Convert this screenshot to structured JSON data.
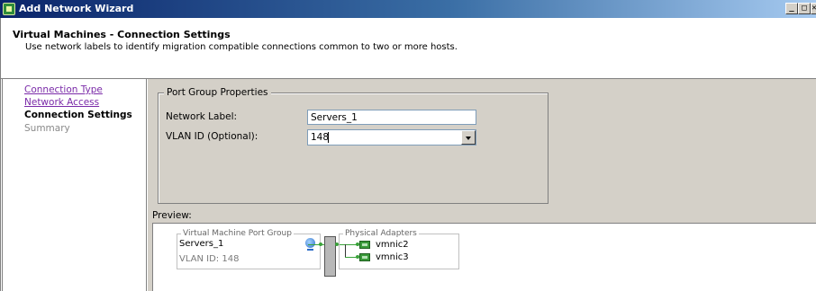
{
  "window": {
    "title": "Add Network Wizard",
    "min_label": "_",
    "max_label": "□",
    "close_label": "✕"
  },
  "header": {
    "title": "Virtual Machines - Connection Settings",
    "description": "Use network labels to identify migration compatible connections common to two or more hosts."
  },
  "nav": {
    "items": [
      {
        "label": "Connection Type",
        "state": "link"
      },
      {
        "label": "Network Access",
        "state": "link"
      },
      {
        "label": "Connection Settings",
        "state": "current"
      },
      {
        "label": "Summary",
        "state": "disabled"
      }
    ]
  },
  "port_group": {
    "legend": "Port Group Properties",
    "network_label": "Network Label:",
    "network_label_value": "Servers_1",
    "vlan_label": "VLAN ID (Optional):",
    "vlan_value": "148"
  },
  "preview": {
    "label": "Preview:",
    "vm_group_legend": "Virtual Machine Port Group",
    "vm_name": "Servers_1",
    "vm_vlan": "VLAN ID: 148",
    "adapters_legend": "Physical Adapters",
    "adapters": [
      "vmnic2",
      "vmnic3"
    ]
  },
  "colors": {
    "titlebar": "#0a246a",
    "link": "#7a2aa8",
    "background": "#d4d0c8",
    "connector": "#3aa33a"
  }
}
